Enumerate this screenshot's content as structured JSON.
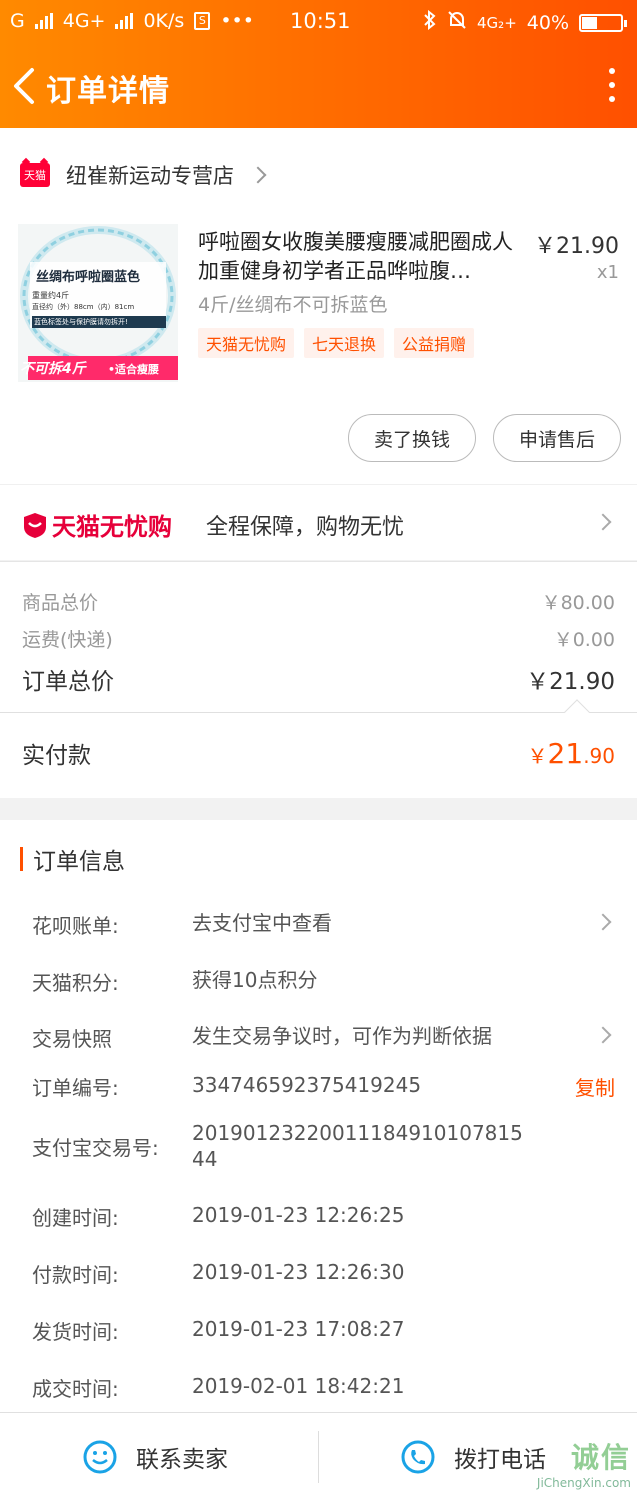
{
  "status_bar": {
    "carrier": "G",
    "network": "4G+",
    "speed": "0K/s",
    "time": "10:51",
    "network2": "4G₂+",
    "battery": "40%",
    "battery_level": 0.4
  },
  "header": {
    "title": "订单详情"
  },
  "store": {
    "badge": "天猫",
    "name": "纽崔新运动专营店"
  },
  "product": {
    "title": "呼啦圈女收腹美腰瘦腰减肥圈成人加重健身初学者正品哗啦腹…",
    "price": "￥21.90",
    "quantity": "x1",
    "spec": "4斤/丝绸布不可拆蓝色",
    "tags": [
      "天猫无忧购",
      "七天退换",
      "公益捐赠"
    ],
    "thumb": {
      "line1": "丝绸布呼啦圈蓝色",
      "line2": "重量约4斤",
      "line3": "直径约（外）88cm（内）81cm",
      "line4": "蓝色标签处与保护膜请勿拆开!",
      "badge_left": "不可拆4斤",
      "badge_right": "•适合瘦腰"
    }
  },
  "actions": {
    "sell": "卖了换钱",
    "after_sale": "申请售后"
  },
  "worry_free": {
    "logo": "天猫无忧购",
    "text": "全程保障，购物无忧"
  },
  "price": {
    "goods_label": "商品总价",
    "goods_value": "￥80.00",
    "shipping_label": "运费(快递)",
    "shipping_value": "￥0.00",
    "total_label": "订单总价",
    "total_value": "￥21.90",
    "paid_label": "实付款",
    "paid_yen": "￥",
    "paid_int": "21",
    "paid_dec": ".90"
  },
  "order_info": {
    "title": "订单信息",
    "rows": [
      {
        "key": "花呗账单:",
        "value": "去支付宝中查看"
      },
      {
        "key": "天猫积分:",
        "value": "获得10点积分"
      },
      {
        "key": "交易快照",
        "value": "发生交易争议时，可作为判断依据"
      },
      {
        "key": "订单编号:",
        "value": "334746592375419245",
        "action": "复制"
      },
      {
        "key": "支付宝交易号:",
        "value": "2019012322001118491010781544"
      },
      {
        "key": "创建时间:",
        "value": "2019-01-23 12:26:25"
      },
      {
        "key": "付款时间:",
        "value": "2019-01-23 12:26:30"
      },
      {
        "key": "发货时间:",
        "value": "2019-01-23 17:08:27"
      },
      {
        "key": "成交时间:",
        "value": "2019-02-01 18:42:21"
      }
    ]
  },
  "bottom_bar": {
    "contact_seller": "联系卖家",
    "call": "拨打电话"
  },
  "watermark": {
    "text": "诚信",
    "url": "JiChengXin.com"
  }
}
